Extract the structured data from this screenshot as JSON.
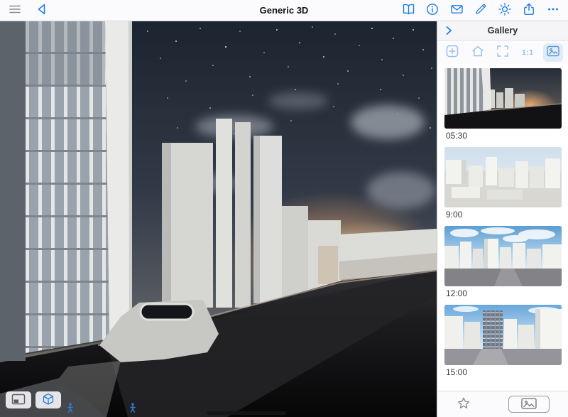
{
  "topbar": {
    "title": "Generic 3D",
    "left_icons": [
      "menu",
      "back"
    ],
    "right_icons": [
      "bookmarks",
      "info",
      "mail",
      "pencil",
      "sun-settings",
      "share",
      "more"
    ]
  },
  "viewport": {
    "overlay_buttons": [
      "preview-window",
      "orientation-cube"
    ],
    "markers": [
      "walk-marker",
      "walk-marker"
    ]
  },
  "sidebar": {
    "title": "Gallery",
    "toolbar": {
      "icons": [
        "add",
        "home",
        "zoom-fit",
        "one-to-one",
        "photos"
      ],
      "one_to_one_label": "1:1",
      "active_icon": "photos"
    },
    "items": [
      {
        "time": "05:30",
        "variant": "dusk"
      },
      {
        "time": "9:00",
        "variant": "morning"
      },
      {
        "time": "12:00",
        "variant": "noon"
      },
      {
        "time": "15:00",
        "variant": "afternoon"
      }
    ],
    "footer_tabs": [
      "favorites-star",
      "photos"
    ]
  },
  "colors": {
    "accent_blue": "#1e7ce3",
    "muted_toolbar_blue": "#98bce6",
    "sunset_glow": "#efb57e"
  }
}
